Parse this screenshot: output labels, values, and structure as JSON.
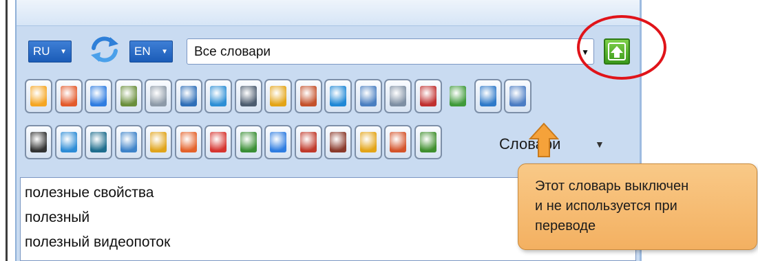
{
  "toolbar": {
    "source_lang": "RU",
    "target_lang": "EN",
    "dictionary_select": {
      "value": "Все словари"
    },
    "swap_icon": "swap-arrows-icon",
    "up_button_icon": "arrow-up-icon"
  },
  "dictionaries": {
    "label": "Словари",
    "row1": [
      {
        "icon": "book-icon",
        "color": "#f5a623"
      },
      {
        "icon": "notepad-icon",
        "color": "#e35a2b"
      },
      {
        "icon": "chat-icon",
        "color": "#2f7de1"
      },
      {
        "icon": "statue-icon",
        "color": "#6a8f3c"
      },
      {
        "icon": "mouse-icon",
        "color": "#8d9aa8"
      },
      {
        "icon": "monitor-icon",
        "color": "#2f6fb8"
      },
      {
        "icon": "satellite-icon",
        "color": "#2d8fd5"
      },
      {
        "icon": "phone-icon",
        "color": "#4d5d70"
      },
      {
        "icon": "coin-icon",
        "color": "#e3a417"
      },
      {
        "icon": "speaker-icon",
        "color": "#c4512b"
      },
      {
        "icon": "globe-icon",
        "color": "#1f88d6"
      },
      {
        "icon": "scales-icon",
        "color": "#4a7fc1"
      },
      {
        "icon": "registered-icon",
        "color": "#7e8fa3"
      },
      {
        "icon": "magnet-icon",
        "color": "#c0302f"
      },
      {
        "icon": "medical-icon",
        "color": "#3f9a3a",
        "disabled": true
      },
      {
        "icon": "microscope-icon",
        "color": "#2f7ac9"
      },
      {
        "icon": "head-icon",
        "color": "#4c7dc4"
      }
    ],
    "row2": [
      {
        "icon": "ball-icon",
        "color": "#333333"
      },
      {
        "icon": "gear-icon",
        "color": "#2d8cd6"
      },
      {
        "icon": "building-icon",
        "color": "#1f6e8e"
      },
      {
        "icon": "bus-icon",
        "color": "#3e83c9"
      },
      {
        "icon": "forklift-icon",
        "color": "#e0a41b"
      },
      {
        "icon": "torch-icon",
        "color": "#e4622b"
      },
      {
        "icon": "molecule-icon",
        "color": "#d6342f"
      },
      {
        "icon": "earth-icon",
        "color": "#3a8f36"
      },
      {
        "icon": "message-icon",
        "color": "#2f7de1"
      },
      {
        "icon": "abc-book-icon",
        "color": "#c03a2b"
      },
      {
        "icon": "open-book-icon",
        "color": "#8a3a2b"
      },
      {
        "icon": "star-book-icon",
        "color": "#e3a417"
      },
      {
        "icon": "kids-book-icon",
        "color": "#d4542b"
      },
      {
        "icon": "tree-book-icon",
        "color": "#3f8f2e"
      }
    ]
  },
  "results": [
    "полезные свойства",
    "полезный",
    "полезный видеопоток"
  ],
  "tooltip": {
    "lines": [
      "Этот словарь выключен",
      "и не используется при",
      "переводе"
    ]
  },
  "colors": {
    "accent": "#1b5cb8",
    "highlight_ring": "#e0141a",
    "tooltip_bg": "#f3b061"
  }
}
